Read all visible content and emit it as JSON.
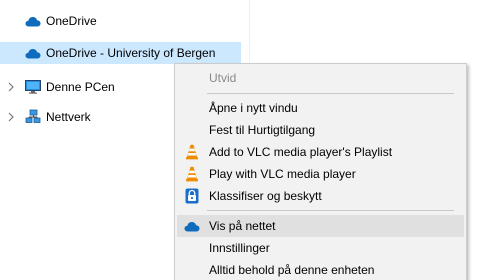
{
  "nav": {
    "items": [
      {
        "label": "OneDrive",
        "icon": "onedrive-cloud-icon",
        "expandable": false,
        "selected": false
      },
      {
        "label": "OneDrive - University of Bergen",
        "icon": "onedrive-cloud-icon",
        "expandable": false,
        "selected": true
      },
      {
        "label": "Denne PCen",
        "icon": "computer-icon",
        "expandable": true,
        "selected": false
      },
      {
        "label": "Nettverk",
        "icon": "network-icon",
        "expandable": true,
        "selected": false
      }
    ]
  },
  "context_menu": {
    "items": [
      {
        "label": "Utvid",
        "enabled": false,
        "icon": null
      },
      {
        "label": "Åpne i nytt vindu",
        "enabled": true,
        "icon": null
      },
      {
        "label": "Fest til Hurtigtilgang",
        "enabled": true,
        "icon": null
      },
      {
        "label": "Add to VLC media player's Playlist",
        "enabled": true,
        "icon": "vlc-cone-icon"
      },
      {
        "label": "Play with VLC media player",
        "enabled": true,
        "icon": "vlc-cone-icon"
      },
      {
        "label": "Klassifiser og beskytt",
        "enabled": true,
        "icon": "azure-information-protection-icon"
      },
      {
        "label": "Vis på nettet",
        "enabled": true,
        "icon": "onedrive-cloud-icon",
        "highlighted": true
      },
      {
        "label": "Innstillinger",
        "enabled": true,
        "icon": null
      },
      {
        "label": "Alltid behold på denne enheten",
        "enabled": true,
        "icon": null
      }
    ]
  },
  "colors": {
    "selection": "#cce8ff",
    "menu_background": "#f2f2f2",
    "menu_hover": "#e0e0e0",
    "onedrive_blue": "#0f6cbd",
    "vlc_orange": "#f08c00"
  }
}
